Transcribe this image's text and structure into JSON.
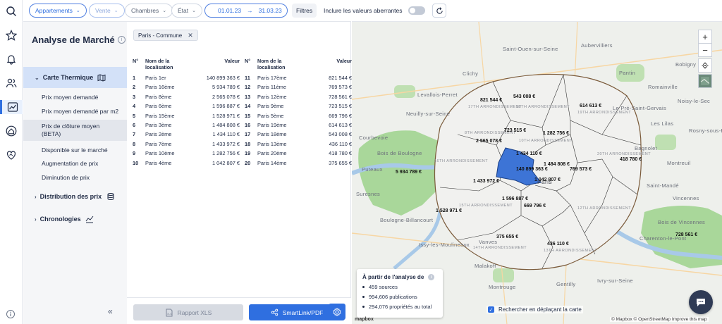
{
  "topbar": {
    "chips": [
      {
        "label": "Appartements",
        "style": "blue"
      },
      {
        "label": "Vente",
        "style": "blue faded"
      },
      {
        "label": "Chambres",
        "style": "plain"
      },
      {
        "label": "État",
        "style": "plain"
      }
    ],
    "date_start": "01.01.23",
    "date_arrow": "→",
    "date_end": "31.03.23",
    "filters_label": "Filtres",
    "aberrant_label": "Inclure les valeurs aberrantes",
    "aberrant_toggle": false
  },
  "rail": {
    "icons": [
      "search-icon",
      "star-icon",
      "bell-icon",
      "users-icon",
      "chart-line-icon",
      "home-euro-icon",
      "handshake-heart-icon"
    ],
    "active": "chart-line-icon",
    "bottom_icon": "info-icon"
  },
  "sidebar": {
    "title": "Analyse de Marché",
    "sections": [
      {
        "label": "Carte Thermique",
        "icon": "map-icon",
        "expanded": true
      },
      {
        "label": "Distribution des prix",
        "icon": "coins-icon",
        "expanded": false
      },
      {
        "label": "Chronologies",
        "icon": "trend-icon",
        "expanded": false
      }
    ],
    "sub_items": [
      "Prix moyen demandé",
      "Prix moyen demandé par m2",
      "Prix de clôture moyen",
      "(BETA)",
      "Disponible sur le marché",
      "Augmentation de prix",
      "Diminution de prix"
    ],
    "selected_sub": "Prix de clôture moyen (BETA)",
    "collapse_glyph": "«"
  },
  "panel": {
    "tag": "Paris - Commune",
    "table_headers": {
      "num": "N°",
      "name_line1": "Nom de la",
      "name_line2": "localisation",
      "value": "Valeur"
    },
    "rows_left": [
      {
        "n": "1",
        "name": "Paris 1er",
        "value": "140 899 363 €"
      },
      {
        "n": "2",
        "name": "Paris 16ème",
        "value": "5 934 789 €"
      },
      {
        "n": "3",
        "name": "Paris 8ème",
        "value": "2 565 078 €"
      },
      {
        "n": "4",
        "name": "Paris 6ème",
        "value": "1 596 887 €"
      },
      {
        "n": "5",
        "name": "Paris 15ème",
        "value": "1 528 971 €"
      },
      {
        "n": "6",
        "name": "Paris 3ème",
        "value": "1 484 808 €"
      },
      {
        "n": "7",
        "name": "Paris 2ème",
        "value": "1 434 110 €"
      },
      {
        "n": "8",
        "name": "Paris 7ème",
        "value": "1 433 972 €"
      },
      {
        "n": "9",
        "name": "Paris 10ème",
        "value": "1 282 756 €"
      },
      {
        "n": "10",
        "name": "Paris 4ème",
        "value": "1 042 807 €"
      }
    ],
    "rows_right": [
      {
        "n": "11",
        "name": "Paris 17ème",
        "value": "821 544 €"
      },
      {
        "n": "12",
        "name": "Paris 11ème",
        "value": "769 573 €"
      },
      {
        "n": "13",
        "name": "Paris 12ème",
        "value": "728 561 €"
      },
      {
        "n": "14",
        "name": "Paris 9ème",
        "value": "723 515 €"
      },
      {
        "n": "15",
        "name": "Paris 5ème",
        "value": "669 796 €"
      },
      {
        "n": "16",
        "name": "Paris 19ème",
        "value": "614 613 €"
      },
      {
        "n": "17",
        "name": "Paris 18ème",
        "value": "543 008 €"
      },
      {
        "n": "18",
        "name": "Paris 13ème",
        "value": "436 110 €"
      },
      {
        "n": "19",
        "name": "Paris 20ème",
        "value": "418 780 €"
      },
      {
        "n": "20",
        "name": "Paris 14ème",
        "value": "375 655 €"
      }
    ],
    "btn_xls": "Rapport XLS",
    "btn_smart": "SmartLink/PDF"
  },
  "map": {
    "zoom_in": "+",
    "zoom_out": "−",
    "price_labels": [
      "821 544 €",
      "543 008 €",
      "614 613 €",
      "723 515 €",
      "1 282 756 €",
      "2 565 078 €",
      "1 434 110 €",
      "418 780 €",
      "5 934 789 €",
      "140 899 363 €",
      "1 484 808 €",
      "769 573 €",
      "1 433 972 €",
      "1 042 807 €",
      "1 596 887 €",
      "669 796 €",
      "1 528 971 €",
      "375 655 €",
      "436 110 €",
      "728 561 €"
    ],
    "places": [
      "Saint-Ouen-sur-Seine",
      "Aubervilliers",
      "Pantin",
      "Bobigny",
      "Clichy",
      "Levallois-Perret",
      "Neuilly-sur-Seine",
      "Noisy-le-Sec",
      "Bagnolet",
      "Montreuil",
      "Paris",
      "Vincennes",
      "Boulogne-Billancourt",
      "Issy-les-Moulineaux",
      "Vanves",
      "Malakoff",
      "Montrouge",
      "Gentilly",
      "Ivry-sur-Seine",
      "Charenton-le-Pont",
      "Saint-Mandé",
      "Romainville",
      "Les Lilas",
      "Le Pré-Saint-Gervais",
      "Rosny-sous-Bois",
      "Puteaux",
      "Suresnes",
      "Courbevoie",
      "Bois de Boulogne",
      "Bois de Vincennes"
    ],
    "arrondissements": [
      "17TH ARRONDISSEMENT",
      "18TH ARRONDISSEMENT",
      "19TH ARRONDISSEMENT",
      "8TH ARRONDISSEMENT",
      "10TH ARRONDISSEMENT",
      "20TH ARRONDISSEMENT",
      "16TH ARRONDISSEMENT",
      "12TH ARRONDISSEMENT",
      "15TH ARRONDISSEMENT",
      "14TH ARRONDISSEMENT",
      "13TH ARRONDISSEMENT"
    ],
    "info_title": "À partir de l'analyse de",
    "info_lines": [
      "459 sources",
      "994,606 publications",
      "294,076 propriétés au total"
    ],
    "search_move_label": "Rechercher en déplaçant la carte",
    "search_move_checked": true,
    "attribution": "© Mapbox © OpenStreetMap  Improve this map",
    "mapbox_logo": "mapbox"
  },
  "colors": {
    "accent": "#2f6fe0",
    "selected_district": "#3d74d6",
    "park": "#a9d79a",
    "water": "#a8c9e8"
  }
}
